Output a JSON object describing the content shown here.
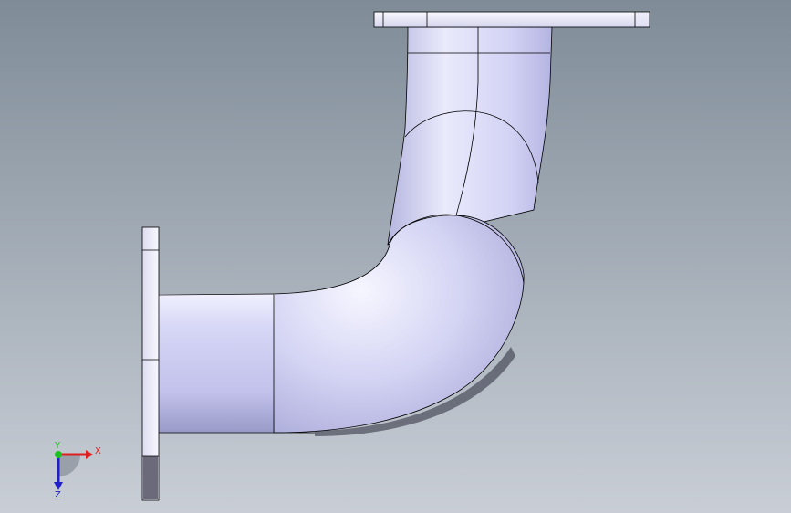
{
  "viewport": {
    "background_top": "#7f8c98",
    "background_bottom": "#c9ced6",
    "model_base": "#c8c9f0",
    "model_highlight": "#f4f4ff",
    "model_shadow": "#8a8ab8",
    "edge_color": "#000000"
  },
  "model": {
    "name": "pipe-elbow-90deg-with-flanges"
  },
  "triad": {
    "x_label": "X",
    "y_label": "Y",
    "z_label": "Z",
    "x_color": "#e02020",
    "y_color": "#20c020",
    "z_color": "#2020c8"
  }
}
